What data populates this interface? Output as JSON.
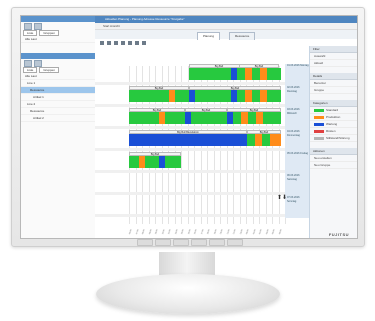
{
  "monitor": {
    "brand": "FUJITSU"
  },
  "left_panel": {
    "tabs": [
      "Liste",
      "Gruppen"
    ],
    "top_tree": [
      "Alle Laut"
    ],
    "tree": [
      "Alle Laut",
      "Line 1",
      "Ressource",
      "Artikel 1",
      "Line 2",
      "Ressource",
      "Artikel 2"
    ]
  },
  "app": {
    "title": "Aktuellen Planung - Planung Adresse Ressource \"Freigabe\"",
    "menu": "Start   Ansicht",
    "tabs": [
      "Planung",
      "Ressource"
    ]
  },
  "gantt": {
    "colors": {
      "green": "#27c93f",
      "orange": "#ff8c1a",
      "blue": "#1a4fd6",
      "gray": "#b5b5b5",
      "light": "#e9e9e9"
    },
    "rows": [
      {
        "label": "01.03.2016 Montag",
        "headers": [
          "Big Bull",
          "Big Bull"
        ]
      },
      {
        "label": "02.03.2016 Dienstag",
        "headers": [
          "Big Bull",
          "Big Bull"
        ]
      },
      {
        "label": "03.03.2016 Mittwoch",
        "headers": [
          "Big Bull",
          "Big Bull",
          "Big Bull"
        ]
      },
      {
        "label": "04.03.2016 Donnerstag",
        "headers": [
          "Big Bull Blendstrom",
          "Big Bull"
        ]
      },
      {
        "label": "05.03.2016 Freitag",
        "headers": [
          "Big Bull"
        ]
      },
      {
        "label": "06.03.2016 Samstag",
        "headers": []
      },
      {
        "label": "07.03.2016 Sonntag",
        "headers": []
      }
    ],
    "ticks": [
      "06:00",
      "07:00",
      "08:00",
      "09:00",
      "10:00",
      "11:00",
      "12:00",
      "13:00",
      "14:00",
      "15:00",
      "16:00",
      "17:00",
      "18:00",
      "19:00",
      "20:00",
      "21:00",
      "22:00",
      "23:00",
      "00:00",
      "01:00",
      "02:00",
      "03:00",
      "04:00",
      "05:00"
    ]
  },
  "right_panel": {
    "sections": [
      {
        "title": "Filter",
        "items": [
          "Auswahl",
          "Aktuell"
        ]
      },
      {
        "title": "Details",
        "items": [
          "Benutzer",
          "Gruppe"
        ]
      },
      {
        "title": "Kategorien",
        "items": [
          "Standard",
          "Produktion",
          "Wartung",
          "Rüsten",
          "Stillstand/Störung"
        ]
      },
      {
        "title": "Aktionen",
        "items": [
          "Neu erstellen",
          "Neu Gruppe"
        ]
      }
    ]
  }
}
